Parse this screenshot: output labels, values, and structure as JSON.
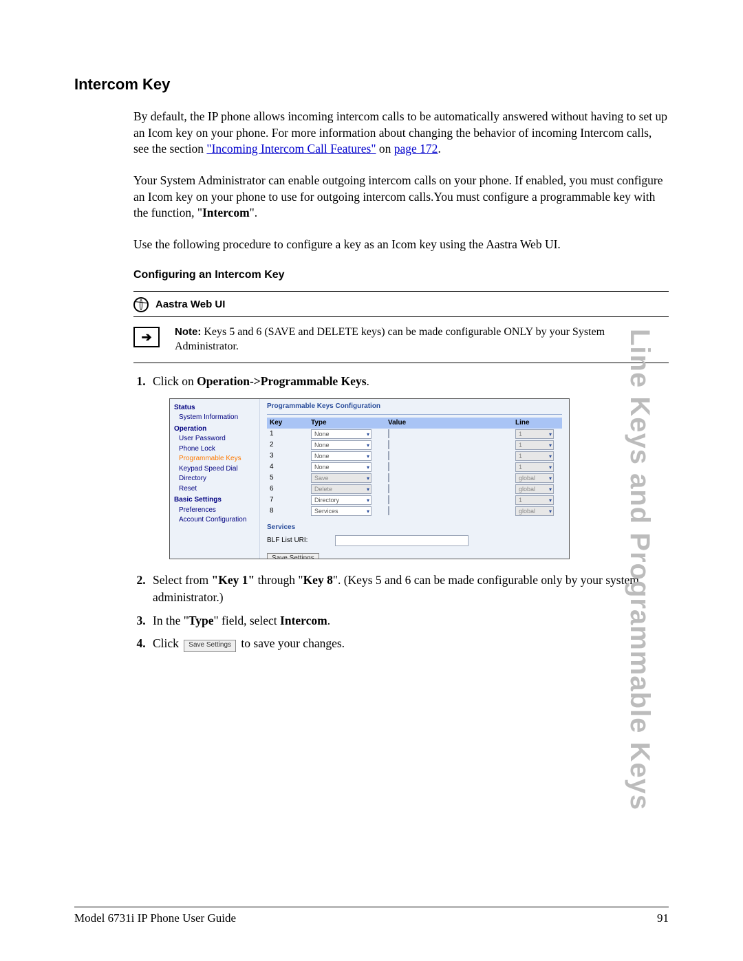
{
  "side_tab": "Line Keys and Programmable Keys",
  "heading": "Intercom Key",
  "para1a": "By default, the IP phone allows incoming intercom calls to be automatically answered without having to set up an Icom key on your phone. For more information about changing the behavior of incoming Intercom calls, see the section ",
  "link1": "\"Incoming Intercom Call Features\"",
  "para1b": " on ",
  "link2": "page 172",
  "para1c": ".",
  "para2": "Your System Administrator can enable outgoing intercom calls on your phone. If enabled, you must configure an Icom key on your phone to use for outgoing intercom calls.You must configure a programmable key with the function, \"",
  "para2bold": "Intercom",
  "para2c": "\".",
  "para3": "Use the following procedure to configure a key as an Icom key using the Aastra Web UI.",
  "subheading": "Configuring an Intercom Key",
  "aastra_label": "Aastra Web UI",
  "note_label": "Note:",
  "note_text": " Keys 5 and 6 (SAVE and DELETE keys) can be made configurable ONLY by your System Administrator.",
  "step1a": "Click on ",
  "step1b": "Operation->Programmable Keys",
  "step1c": ".",
  "step2a": "Select from ",
  "step2b": "\"Key 1\"",
  "step2c": " through \"",
  "step2d": "Key 8",
  "step2e": "\". (Keys 5 and 6 can be made configurable only by your system administrator.)",
  "step3a": "In the \"",
  "step3b": "Type",
  "step3c": "\" field, select ",
  "step3d": "Intercom",
  "step3e": ".",
  "step4a": "Click ",
  "step4btn": "Save Settings",
  "step4b": " to save your changes.",
  "ss": {
    "title": "Programmable Keys Configuration",
    "nav": {
      "status": "Status",
      "sysinfo": "System Information",
      "operation": "Operation",
      "userpass": "User Password",
      "phonelock": "Phone Lock",
      "progkeys": "Programmable Keys",
      "speeddial": "Keypad Speed Dial",
      "directory": "Directory",
      "reset": "Reset",
      "basic": "Basic Settings",
      "prefs": "Preferences",
      "acctcfg": "Account Configuration"
    },
    "hdr": {
      "key": "Key",
      "type": "Type",
      "value": "Value",
      "line": "Line"
    },
    "rows": [
      {
        "key": "1",
        "type": "None",
        "type_enabled": true,
        "val_enabled": true,
        "line": "1",
        "line_enabled": false
      },
      {
        "key": "2",
        "type": "None",
        "type_enabled": true,
        "val_enabled": true,
        "line": "1",
        "line_enabled": false
      },
      {
        "key": "3",
        "type": "None",
        "type_enabled": true,
        "val_enabled": true,
        "line": "1",
        "line_enabled": false
      },
      {
        "key": "4",
        "type": "None",
        "type_enabled": true,
        "val_enabled": true,
        "line": "1",
        "line_enabled": false
      },
      {
        "key": "5",
        "type": "Save",
        "type_enabled": false,
        "val_enabled": false,
        "line": "global",
        "line_enabled": false
      },
      {
        "key": "6",
        "type": "Delete",
        "type_enabled": false,
        "val_enabled": false,
        "line": "global",
        "line_enabled": false
      },
      {
        "key": "7",
        "type": "Directory",
        "type_enabled": true,
        "val_enabled": true,
        "line": "1",
        "line_enabled": false
      },
      {
        "key": "8",
        "type": "Services",
        "type_enabled": true,
        "val_enabled": true,
        "line": "global",
        "line_enabled": false
      }
    ],
    "services_label": "Services",
    "blf_label": "BLF List URI:",
    "save_btn": "Save Settings"
  },
  "footer": {
    "left": "Model 6731i IP Phone User Guide",
    "right": "91"
  }
}
